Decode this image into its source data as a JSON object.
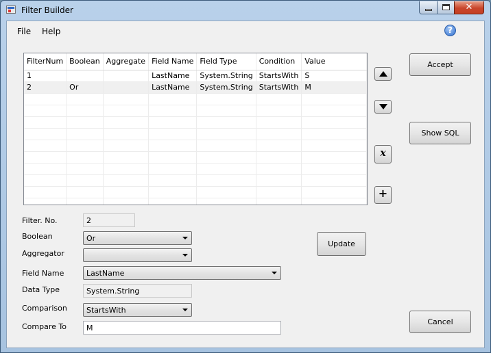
{
  "window": {
    "title": "Filter Builder"
  },
  "menu": {
    "file": "File",
    "help": "Help"
  },
  "grid": {
    "columns": [
      "FilterNum",
      "Boolean",
      "Aggregate",
      "Field Name",
      "Field Type",
      "Condition",
      "Value"
    ],
    "rows": [
      [
        "1",
        "",
        "",
        "LastName",
        "System.String",
        "StartsWith",
        "S"
      ],
      [
        "2",
        "Or",
        "",
        "LastName",
        "System.String",
        "StartsWith",
        "M"
      ]
    ]
  },
  "buttons": {
    "accept": "Accept",
    "show_sql": "Show SQL",
    "update": "Update",
    "cancel": "Cancel",
    "remove_glyph": "x",
    "add_glyph": "+"
  },
  "form": {
    "filter_no": {
      "label": "Filter. No.",
      "value": "2"
    },
    "boolean": {
      "label": "Boolean",
      "value": "Or"
    },
    "aggregator": {
      "label": "Aggregator",
      "value": ""
    },
    "field_name": {
      "label": "Field Name",
      "value": "LastName"
    },
    "data_type": {
      "label": "Data Type",
      "value": "System.String"
    },
    "comparison": {
      "label": "Comparison",
      "value": "StartsWith"
    },
    "compare_to": {
      "label": "Compare To",
      "value": "M"
    }
  },
  "icons": {
    "app": "filter-builder-app-icon",
    "help": "help-question-icon",
    "move_up": "triangle-up-icon",
    "move_down": "triangle-down-icon",
    "remove": "remove-x-icon",
    "add": "plus-icon"
  }
}
